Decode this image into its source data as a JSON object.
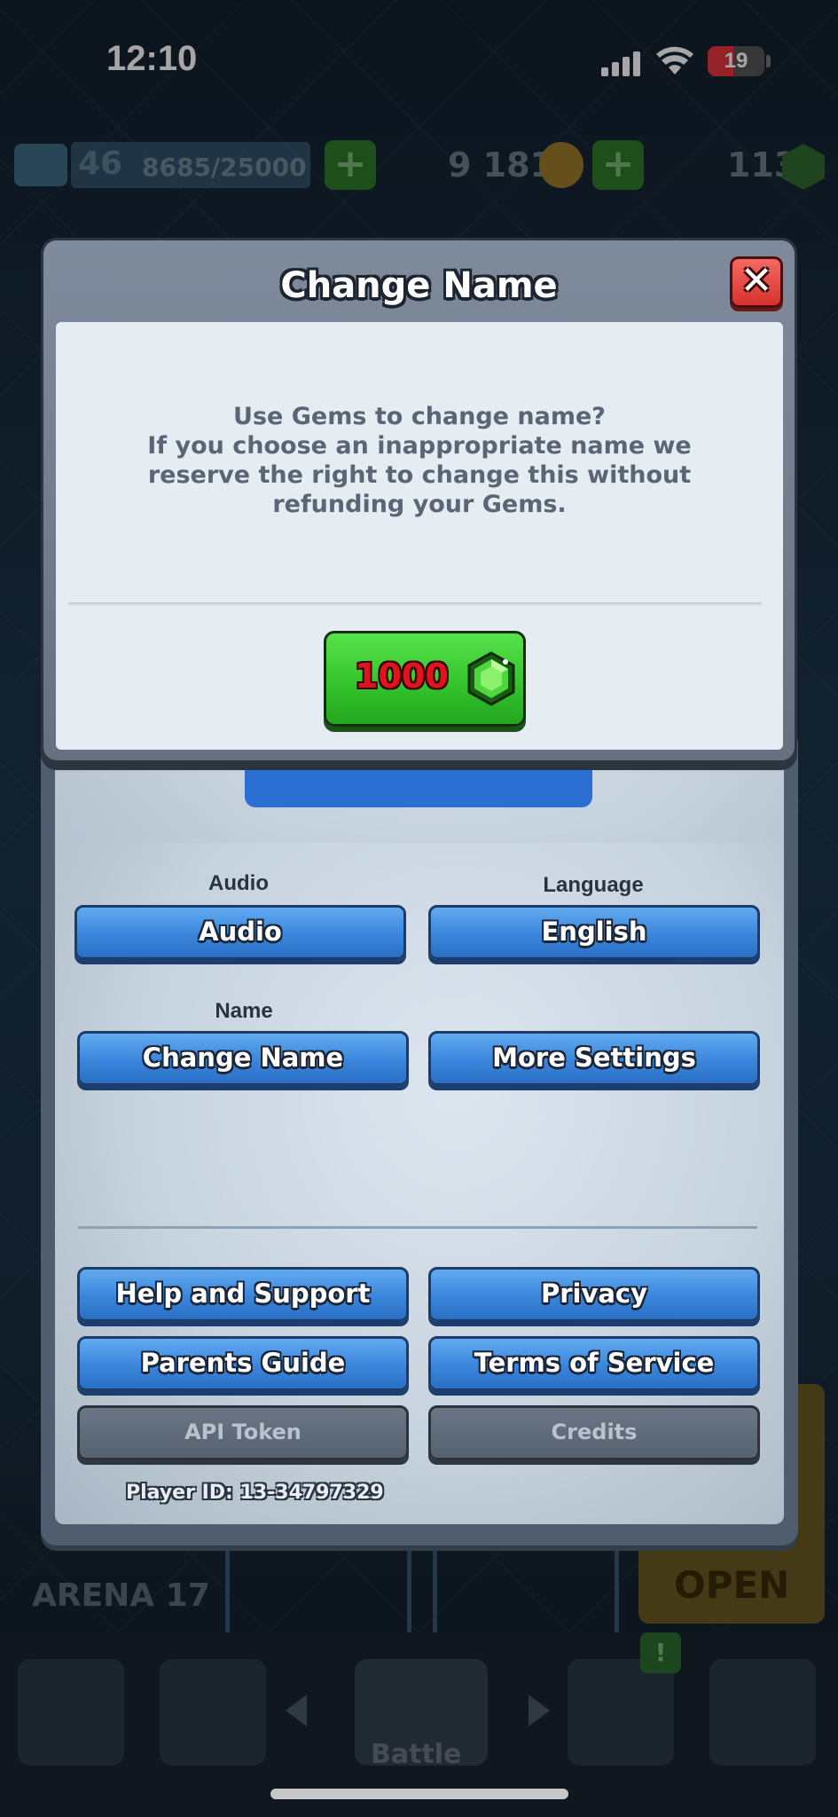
{
  "status_bar": {
    "time": "12:10",
    "battery": "19"
  },
  "topbar": {
    "level": "46",
    "xp": "8685/25000",
    "gold": "9 181",
    "gems": "113"
  },
  "background": {
    "arena_label": "ARENA 17",
    "chest_label": "OPEN",
    "nav_badge": "!",
    "nav_center_label": "Battle"
  },
  "modal": {
    "title": "Change Name",
    "close_icon": "close-icon",
    "message_lines": [
      "Use Gems to change name?",
      "If you choose an inappropriate name we",
      "reserve the right to change this without",
      "refunding your Gems."
    ],
    "price": "1000",
    "price_icon": "gem-icon"
  },
  "settings": {
    "audio_label": "Audio",
    "audio_button": "Audio",
    "language_label": "Language",
    "language_button": "English",
    "name_label": "Name",
    "name_button": "Change Name",
    "more_settings_button": "More Settings",
    "help_button": "Help and Support",
    "privacy_button": "Privacy",
    "parents_button": "Parents Guide",
    "terms_button": "Terms of Service",
    "api_token_button": "API Token",
    "credits_button": "Credits",
    "player_id": "Player ID: 13-34797329"
  },
  "colors": {
    "accent_blue": "#3a86dc",
    "gem_green": "#31c22a",
    "price_red": "#e1141e",
    "close_red": "#d7312c"
  }
}
